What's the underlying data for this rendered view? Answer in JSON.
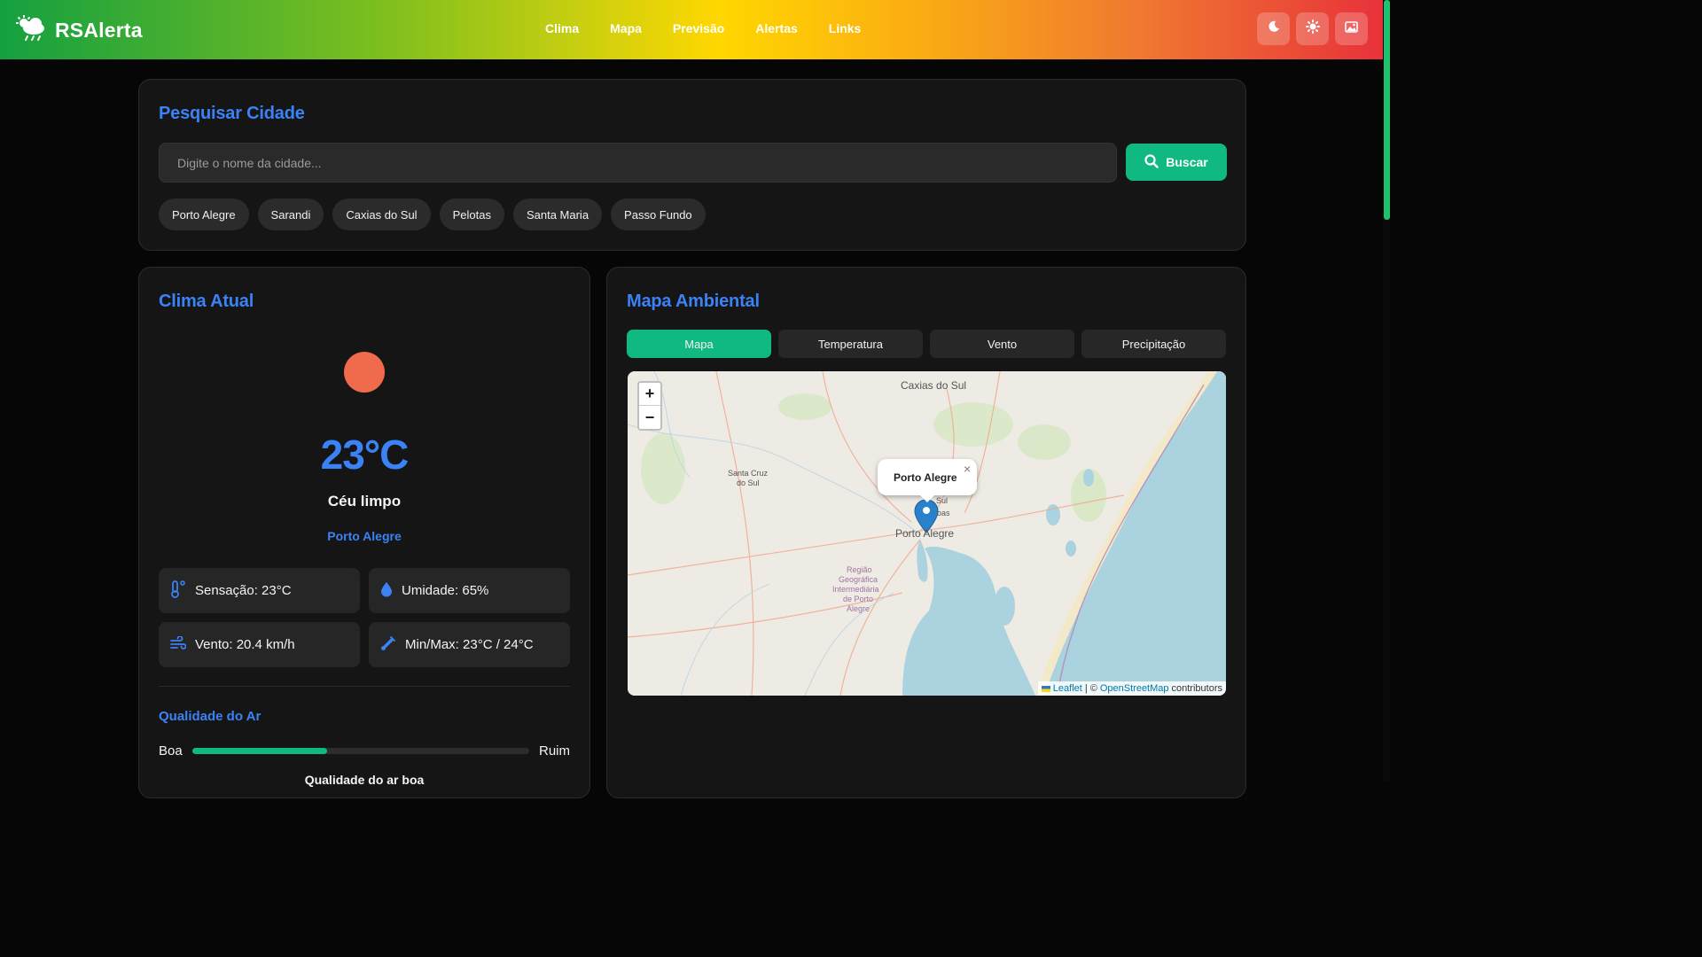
{
  "brand": {
    "name": "RSAlerta",
    "logo_icon": "cloud-sun-rain-icon"
  },
  "nav": [
    {
      "label": "Clima"
    },
    {
      "label": "Mapa"
    },
    {
      "label": "Previsão"
    },
    {
      "label": "Alertas"
    },
    {
      "label": "Links"
    }
  ],
  "header_buttons": [
    {
      "icon": "moon-icon"
    },
    {
      "icon": "sun-icon"
    },
    {
      "icon": "image-icon"
    }
  ],
  "search": {
    "title": "Pesquisar Cidade",
    "placeholder": "Digite o nome da cidade...",
    "button_label": "Buscar",
    "quick_cities": [
      "Porto Alegre",
      "Sarandi",
      "Caxias do Sul",
      "Pelotas",
      "Santa Maria",
      "Passo Fundo"
    ]
  },
  "weather": {
    "title": "Clima Atual",
    "temperature": "23°C",
    "description": "Céu limpo",
    "city": "Porto Alegre",
    "stats": {
      "feels_like": "Sensação: 23°C",
      "humidity": "Umidade: 65%",
      "wind": "Vento: 20.4 km/h",
      "minmax": "Min/Max: 23°C / 24°C"
    },
    "air_quality": {
      "title": "Qualidade do Ar",
      "left_label": "Boa",
      "right_label": "Ruim",
      "level_fraction": 0.4,
      "status_text": "Qualidade do ar boa"
    }
  },
  "map_card": {
    "title": "Mapa Ambiental",
    "tabs": [
      {
        "label": "Mapa",
        "active": true
      },
      {
        "label": "Temperatura",
        "active": false
      },
      {
        "label": "Vento",
        "active": false
      },
      {
        "label": "Precipitação",
        "active": false
      }
    ],
    "zoom_in": "+",
    "zoom_out": "−",
    "popup_label": "Porto Alegre",
    "popup_close": "×",
    "place_labels": {
      "caxias": "Caxias do Sul",
      "santa_cruz_1": "Santa Cruz",
      "santa_cruz_2": "do Sul",
      "porto_alegre": "Porto Alegre",
      "sul": "Sul",
      "boas": "oas",
      "regiao_1": "Região",
      "regiao_2": "Geográfica",
      "regiao_3": "Intermediária",
      "regiao_4": "de Porto",
      "regiao_5": "Alegre"
    },
    "attribution": {
      "leaflet": "Leaflet",
      "separator": "| ©",
      "osm": "OpenStreetMap",
      "suffix": "contributors"
    }
  },
  "colors": {
    "accent_blue": "#3b82f6",
    "accent_green": "#10b981",
    "sun": "#f06b4b"
  }
}
